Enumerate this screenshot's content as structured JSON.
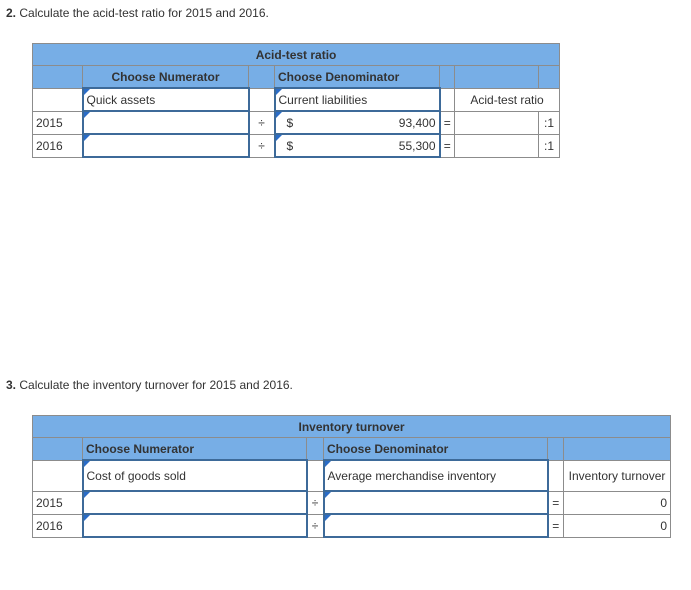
{
  "q2": {
    "number": "2.",
    "text": "Calculate the acid-test ratio for 2015 and 2016.",
    "table": {
      "title": "Acid-test ratio",
      "numerator_header": "Choose Numerator",
      "denominator_header": "Choose Denominator",
      "numerator_label": "Quick assets",
      "denominator_label": "Current liabilities",
      "result_label": "Acid-test ratio",
      "divide_symbol": "÷",
      "equals_symbol": "=",
      "rows": [
        {
          "year": "2015",
          "numerator": "",
          "currency": "$",
          "denominator": "93,400",
          "result": "",
          "suffix": ":1"
        },
        {
          "year": "2016",
          "numerator": "",
          "currency": "$",
          "denominator": "55,300",
          "result": "",
          "suffix": ":1"
        }
      ]
    }
  },
  "q3": {
    "number": "3.",
    "text": "Calculate the inventory turnover for 2015 and 2016.",
    "table": {
      "title": "Inventory turnover",
      "numerator_header": "Choose Numerator",
      "denominator_header": "Choose Denominator",
      "numerator_label": "Cost of goods sold",
      "denominator_label": "Average merchandise inventory",
      "result_label": "Inventory turnover",
      "divide_symbol": "÷",
      "equals_symbol": "=",
      "rows": [
        {
          "year": "2015",
          "numerator": "",
          "denominator": "",
          "result": "0"
        },
        {
          "year": "2016",
          "numerator": "",
          "denominator": "",
          "result": "0"
        }
      ]
    }
  }
}
